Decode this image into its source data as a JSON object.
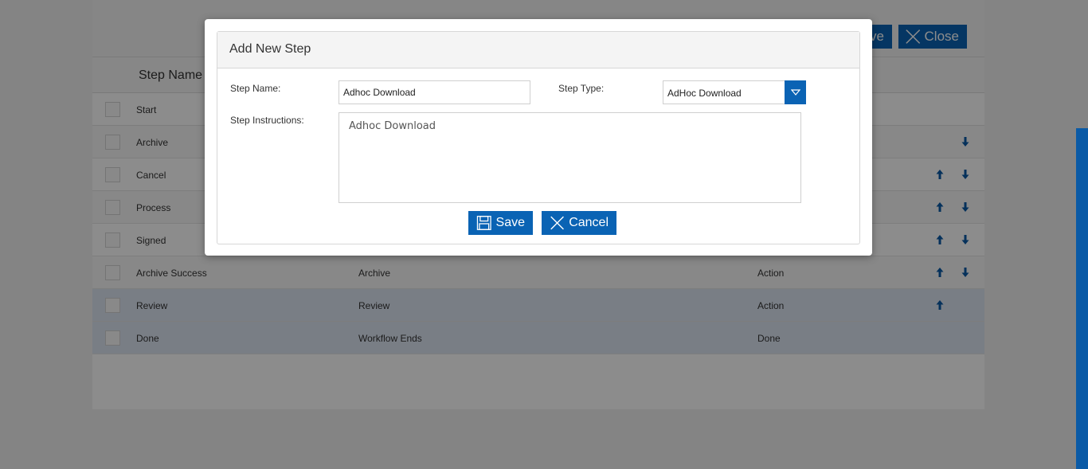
{
  "toolbar": {
    "save_label": "ve",
    "close_label": "Close"
  },
  "table": {
    "header": "Step Name",
    "rows": [
      {
        "name": "Start",
        "type": "",
        "kind": "",
        "up": false,
        "down": false
      },
      {
        "name": "Archive",
        "type": "",
        "kind": "",
        "up": false,
        "down": true
      },
      {
        "name": "Cancel",
        "type": "",
        "kind": "",
        "up": true,
        "down": true
      },
      {
        "name": "Process",
        "type": "",
        "kind": "",
        "up": true,
        "down": true
      },
      {
        "name": "Signed",
        "type": "",
        "kind": "",
        "up": true,
        "down": true
      },
      {
        "name": "Archive Success",
        "type": "Archive",
        "kind": "Action",
        "up": true,
        "down": true
      },
      {
        "name": "Review",
        "type": "Review",
        "kind": "Action",
        "up": true,
        "down": false
      },
      {
        "name": "Done",
        "type": "Workflow Ends",
        "kind": "Done",
        "up": false,
        "down": false
      }
    ]
  },
  "dialog": {
    "title": "Add New Step",
    "step_name_label": "Step Name:",
    "step_name_value": "Adhoc Download",
    "step_type_label": "Step Type:",
    "step_type_value": "AdHoc Download",
    "instructions_label": "Step Instructions:",
    "instructions_value": "Adhoc Download",
    "save_label": "Save",
    "cancel_label": "Cancel"
  },
  "colors": {
    "accent": "#0a63b4",
    "selected_row": "#dde5f3",
    "overlay": "rgba(0,0,0,0.45)"
  },
  "icons": [
    "save-icon",
    "close-icon",
    "arrow-up-icon",
    "arrow-down-icon",
    "dropdown-arrow-icon"
  ]
}
